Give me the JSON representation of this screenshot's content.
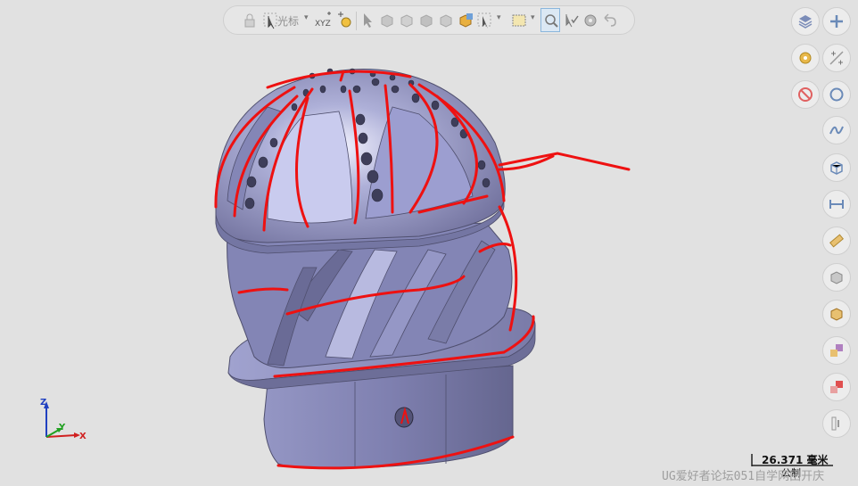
{
  "toolbar": {
    "cursor_label": "光标",
    "xyz_label": "XYZ"
  },
  "scale": {
    "value": "26.371 毫米",
    "unit_system": "公制"
  },
  "triad": {
    "x_label": "X",
    "y_label": "Y",
    "z_label": "Z"
  },
  "watermark": "UG爱好者论坛051自学网田开庆",
  "colors": {
    "model_fill": "#8f8fbd",
    "model_edge": "#5c5c7c",
    "selection_curve": "#ee1111",
    "background": "#e1e1e1"
  },
  "right_toolbar": {
    "icons": [
      "layers-icon",
      "add-icon",
      "settings-icon",
      "snap-icon",
      "cancel-icon",
      "circle-icon",
      "spline-icon",
      "view-box-icon",
      "dimension-icon",
      "measure-icon",
      "shaded-box-icon",
      "render-box-icon",
      "color-palette-icon",
      "color-swap-icon",
      "clip-icon"
    ]
  }
}
